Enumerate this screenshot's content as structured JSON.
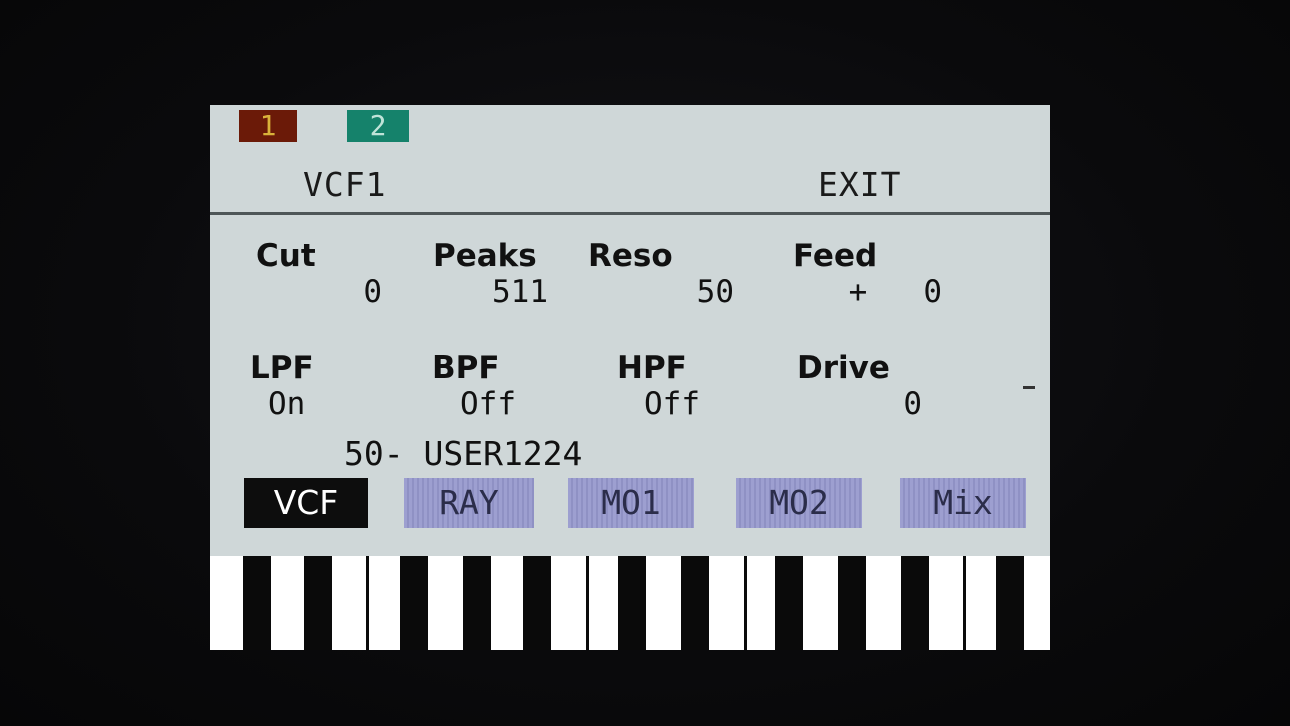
{
  "channels": [
    {
      "label": "1",
      "color": "#6b1a08"
    },
    {
      "label": "2",
      "color": "#15826b"
    }
  ],
  "header": {
    "title": "VCF1",
    "exit_label": "EXIT"
  },
  "params": {
    "row1": [
      {
        "label": "Cut",
        "value": "0"
      },
      {
        "label": "Peaks",
        "value": "511"
      },
      {
        "label": "Reso",
        "value": "50"
      },
      {
        "label": "Feed",
        "value": "+   0"
      }
    ],
    "row2": [
      {
        "label": "LPF",
        "value": "On"
      },
      {
        "label": "BPF",
        "value": "Off"
      },
      {
        "label": "HPF",
        "value": "Off"
      },
      {
        "label": "Drive",
        "value": "0"
      }
    ]
  },
  "preset": {
    "text": "50- USER1224"
  },
  "tabs": [
    {
      "label": "VCF",
      "active": true
    },
    {
      "label": "RAY",
      "active": false
    },
    {
      "label": "MO1",
      "active": false
    },
    {
      "label": "MO2",
      "active": false
    },
    {
      "label": "Mix",
      "active": false
    }
  ]
}
